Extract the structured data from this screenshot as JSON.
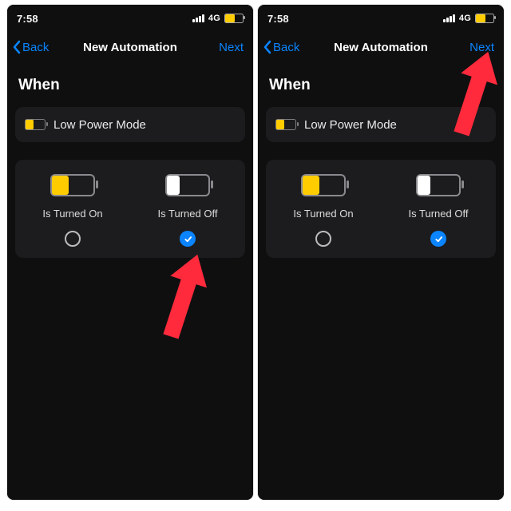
{
  "status": {
    "time": "7:58",
    "network": "4G",
    "battery_color": "#ffcc00",
    "battery_pct": 55
  },
  "nav": {
    "back": "Back",
    "title": "New Automation",
    "next": "Next"
  },
  "heading": "When",
  "trigger": {
    "label": "Low Power Mode",
    "icon_fill_color": "#ffcc00",
    "icon_fill_pct": 40
  },
  "options": {
    "on": {
      "label": "Is Turned On",
      "fill_color": "#ffcc00",
      "fill_pct": 40
    },
    "off": {
      "label": "Is Turned Off",
      "fill_color": "#ffffff",
      "fill_pct": 30
    }
  },
  "screens": [
    {
      "on_checked": false,
      "off_checked": true
    },
    {
      "on_checked": false,
      "off_checked": true
    }
  ],
  "accent": "#0a84ff",
  "arrow_color": "#ff2a3c"
}
